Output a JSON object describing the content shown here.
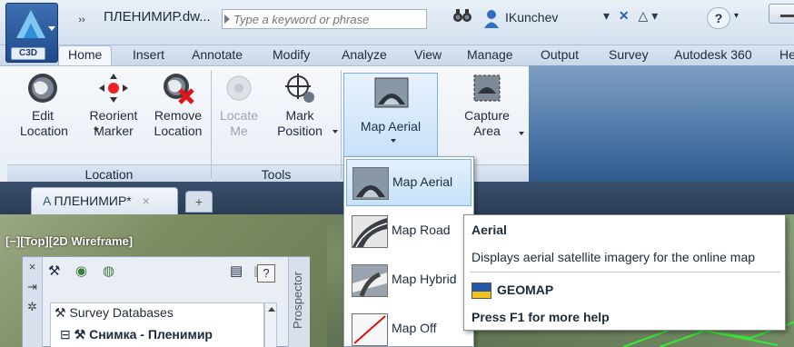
{
  "titlebar": {
    "app_badge": "C3D",
    "qa_more": "››",
    "document_title": "ПЛЕНИМИР.dw...",
    "search_placeholder": "Type a keyword or phrase",
    "user_name": "IKunchev",
    "help_label": "?"
  },
  "ribbon_tabs": [
    {
      "label": "Home",
      "active": true
    },
    {
      "label": "Insert"
    },
    {
      "label": "Annotate"
    },
    {
      "label": "Modify"
    },
    {
      "label": "Analyze"
    },
    {
      "label": "View"
    },
    {
      "label": "Manage"
    },
    {
      "label": "Output"
    },
    {
      "label": "Survey"
    },
    {
      "label": "Autodesk 360"
    },
    {
      "label": "He"
    }
  ],
  "ribbon": {
    "groups": [
      {
        "label": "Location",
        "buttons": [
          {
            "line1": "Edit",
            "line2": "Location",
            "icon": "globe-icon"
          },
          {
            "line1": "Reorient",
            "line2": "Marker",
            "icon": "marker-icon"
          },
          {
            "line1": "Remove",
            "line2": "Location",
            "icon": "globe-remove-icon"
          }
        ]
      },
      {
        "label": "Tools",
        "buttons": [
          {
            "line1": "Locate",
            "line2": "Me",
            "icon": "locate-icon",
            "disabled": true
          },
          {
            "line1": "Mark",
            "line2": "Position",
            "icon": "crosshair-icon"
          }
        ]
      },
      {
        "label": "",
        "buttons": [
          {
            "line1": "Map Aerial",
            "line2": "",
            "icon": "map-aerial-icon"
          },
          {
            "line1": "Capture",
            "line2": "Area",
            "icon": "capture-area-icon"
          }
        ]
      }
    ]
  },
  "file_tab": {
    "label": "ПЛЕНИМИР*",
    "close": "×",
    "add": "+"
  },
  "viewport_label": "[−][Top][2D Wireframe]",
  "palette": {
    "side_buttons": [
      "×",
      "⇥",
      "✲"
    ],
    "help": "?",
    "title": "Prospector",
    "tree": [
      {
        "label": "Survey Databases",
        "bold": false
      },
      {
        "label": "Снимка - Пленимир",
        "bold": true
      }
    ]
  },
  "dropdown": {
    "items": [
      {
        "label": "Map Aerial",
        "selected": true
      },
      {
        "label": "Map Road"
      },
      {
        "label": "Map Hybrid"
      },
      {
        "label": "Map Off"
      }
    ]
  },
  "tooltip": {
    "title": "Aerial",
    "description": "Displays aerial satellite imagery for the online map",
    "command": "GEOMAP",
    "help": "Press F1 for more help"
  },
  "colors": {
    "accent": "#7eb1e3",
    "titlebar": "#d4e0ee",
    "ribbon_dark": "#2f5a8c",
    "menu_selected": "#c6e1f8"
  }
}
